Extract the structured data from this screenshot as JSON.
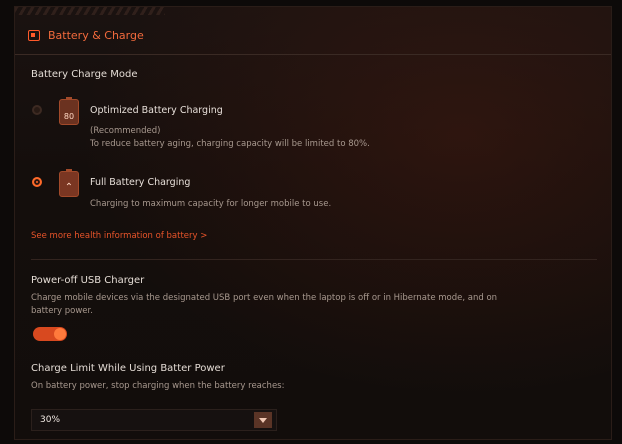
{
  "header": {
    "title": "Battery & Charge",
    "icon": "battery-icon"
  },
  "charge_mode": {
    "title": "Battery Charge Mode",
    "options": [
      {
        "label": "Optimized Battery Charging",
        "icon_text": "80",
        "selected": false,
        "desc1": "(Recommended)",
        "desc2": "To reduce battery aging, charging capacity will be limited to 80%."
      },
      {
        "label": "Full Battery Charging",
        "selected": true,
        "desc1": "Charging to maximum capacity for longer mobile to use."
      }
    ]
  },
  "health_link": "See more health information of battery  >",
  "usb_charger": {
    "title": "Power-off USB Charger",
    "desc1": "Charge mobile devices via the designated USB port even when the laptop is off or in Hibernate mode, and on",
    "desc2": "battery power.",
    "enabled": true
  },
  "charge_limit": {
    "title": "Charge Limit While Using Batter Power",
    "desc": "On battery power, stop charging when the battery reaches:",
    "value": "30%"
  },
  "colors": {
    "accent": "#ff6a2a",
    "link": "#e8542a"
  }
}
